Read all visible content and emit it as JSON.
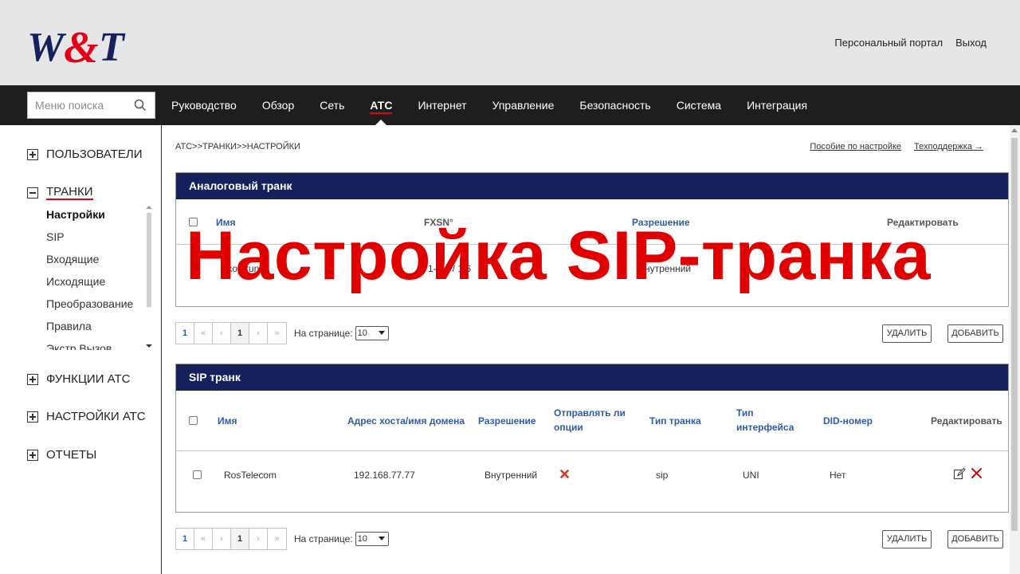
{
  "header": {
    "logo_text": "W&T",
    "links": [
      "Персональный портал",
      "Выход"
    ]
  },
  "nav": {
    "search_placeholder": "Меню поиска",
    "items": [
      "Руководство",
      "Обзор",
      "Сеть",
      "АТС",
      "Интернет",
      "Управление",
      "Безопасность",
      "Система",
      "Интеграция"
    ],
    "active": "АТС"
  },
  "sidebar": {
    "sections": [
      {
        "label": "ПОЛЬЗОВАТЕЛИ",
        "expanded": false
      },
      {
        "label": "ТРАНКИ",
        "expanded": true
      },
      {
        "label": "ФУНКЦИИ АТС",
        "expanded": false
      },
      {
        "label": "НАСТРОЙКИ АТС",
        "expanded": false
      },
      {
        "label": "ОТЧЕТЫ",
        "expanded": false
      }
    ],
    "trunk_items": [
      "Настройки",
      "SIP",
      "Входящие",
      "Исходящие",
      "Преобразование",
      "Правила",
      "Экстр.Вызов"
    ],
    "active_item": "Настройки"
  },
  "main": {
    "breadcrumb": "АТС>>ТРАНКИ>>НАСТРОЙКИ",
    "help_links": [
      "Пособие по настройке",
      "Техподдержка →"
    ],
    "analog": {
      "title": "Аналоговый транк",
      "columns": [
        "Имя",
        "FXSN°",
        "Разрешение",
        "Редактировать"
      ],
      "row": [
        "fxo_trunk",
        "1-6,4 / 1,6",
        "Внутренний"
      ]
    },
    "sip": {
      "title": "SIP транк",
      "columns": [
        "Имя",
        "Адрес хоста/имя домена",
        "Разрешение",
        "Отправлять ли опции",
        "Тип транка",
        "Тип интерфейса",
        "DID-номер",
        "Редактировать"
      ],
      "rows": [
        {
          "name": "RosTelecom",
          "host": "192.168.77.77",
          "permission": "Внутренний",
          "send_options": false,
          "trunk_type": "sip",
          "interface_type": "UNI",
          "did": "Нет"
        }
      ]
    },
    "pager": {
      "first": "1",
      "buttons": [
        "«",
        "‹",
        "1",
        "›",
        "»"
      ],
      "per_page_label": "На странице:",
      "per_page_value": "10"
    },
    "buttons": {
      "delete": "УДАЛИТЬ",
      "add": "ДОБАВИТЬ"
    }
  },
  "overlay_title": "Настройка SIP-транка",
  "colors": {
    "brand_navy": "#16205c",
    "accent_red": "#e30016",
    "overlay_red": "#e00000"
  }
}
